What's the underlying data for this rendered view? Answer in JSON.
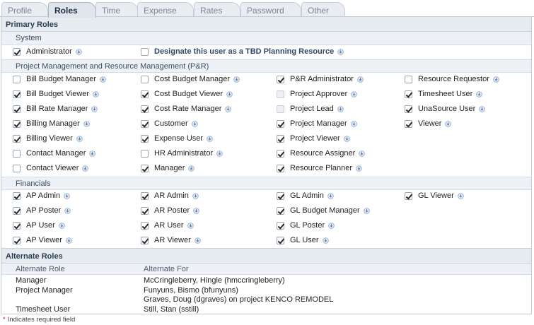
{
  "tabs": [
    "Profile",
    "Roles",
    "Time",
    "Expense",
    "Rates",
    "Password",
    "Other"
  ],
  "active_tab": "Roles",
  "primary_roles": {
    "title": "Primary Roles",
    "system": {
      "title": "System",
      "items": [
        {
          "label": "Administrator",
          "checked": true
        },
        {
          "label": "Designate this user as a TBD Planning Resource",
          "checked": false,
          "strong": true
        }
      ]
    },
    "pmrm": {
      "title": "Project Management and Resource Management (P&R)",
      "columns": [
        [
          {
            "label": "Bill Budget Manager",
            "checked": false
          },
          {
            "label": "Bill Budget Viewer",
            "checked": true
          },
          {
            "label": "Bill Rate Manager",
            "checked": true
          },
          {
            "label": "Billing Manager",
            "checked": true
          },
          {
            "label": "Billing Viewer",
            "checked": true
          },
          {
            "label": "Contact Manager",
            "checked": false
          },
          {
            "label": "Contact Viewer",
            "checked": false
          }
        ],
        [
          {
            "label": "Cost Budget Manager",
            "checked": false
          },
          {
            "label": "Cost Budget Viewer",
            "checked": true
          },
          {
            "label": "Cost Rate Manager",
            "checked": true
          },
          {
            "label": "Customer",
            "checked": true
          },
          {
            "label": "Expense User",
            "checked": true
          },
          {
            "label": "HR Administrator",
            "checked": false
          },
          {
            "label": "Manager",
            "checked": true
          }
        ],
        [
          {
            "label": "P&R Administrator",
            "checked": true
          },
          {
            "label": "Project Approver",
            "checked": false,
            "disabled": true
          },
          {
            "label": "Project Lead",
            "checked": false,
            "disabled": true
          },
          {
            "label": "Project Manager",
            "checked": true
          },
          {
            "label": "Project Viewer",
            "checked": true
          },
          {
            "label": "Resource Assigner",
            "checked": true
          },
          {
            "label": "Resource Planner",
            "checked": true
          }
        ],
        [
          {
            "label": "Resource Requestor",
            "checked": false
          },
          {
            "label": "Timesheet User",
            "checked": true
          },
          {
            "label": "UnaSource User",
            "checked": true
          },
          {
            "label": "Viewer",
            "checked": true
          }
        ]
      ]
    },
    "financials": {
      "title": "Financials",
      "columns": [
        [
          {
            "label": "AP Admin",
            "checked": true
          },
          {
            "label": "AP Poster",
            "checked": true
          },
          {
            "label": "AP User",
            "checked": true
          },
          {
            "label": "AP Viewer",
            "checked": true
          }
        ],
        [
          {
            "label": "AR Admin",
            "checked": true
          },
          {
            "label": "AR Poster",
            "checked": true
          },
          {
            "label": "AR User",
            "checked": true
          },
          {
            "label": "AR Viewer",
            "checked": true
          }
        ],
        [
          {
            "label": "GL Admin",
            "checked": true
          },
          {
            "label": "GL Budget Manager",
            "checked": true
          },
          {
            "label": "GL Poster",
            "checked": true
          },
          {
            "label": "GL User",
            "checked": true
          }
        ],
        [
          {
            "label": "GL Viewer",
            "checked": true
          }
        ]
      ]
    }
  },
  "alternate_roles": {
    "title": "Alternate Roles",
    "col_role": "Alternate Role",
    "col_for": "Alternate For",
    "rows": [
      {
        "role": "Manager",
        "for": [
          "McCringleberry, Hingle (hmccringleberry)"
        ]
      },
      {
        "role": "Project Manager",
        "for": [
          "Funyuns, Bismo (bfunyuns)",
          "Graves, Doug (dgraves) on project KENCO REMODEL"
        ]
      },
      {
        "role": "Timesheet User",
        "for": [
          "Still, Stan (sstill)"
        ]
      }
    ]
  },
  "required_note": "Indicates required field",
  "required_mark": "*",
  "icons": {
    "info": "info-icon",
    "check": "check-icon"
  }
}
